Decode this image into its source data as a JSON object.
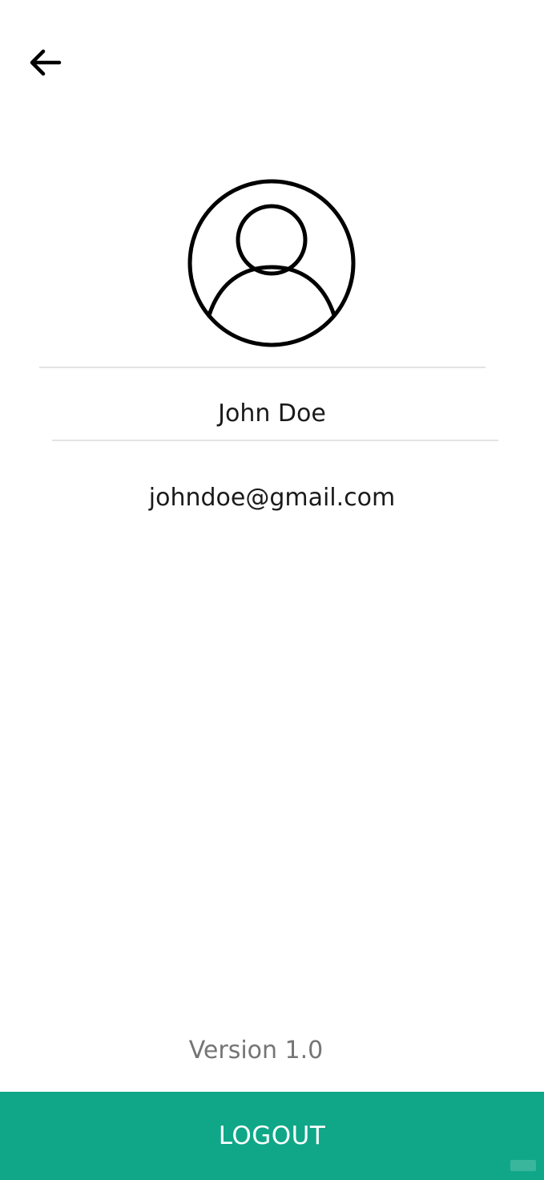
{
  "header": {
    "back_icon": "arrow-left-icon"
  },
  "profile": {
    "avatar_icon": "account-circle-icon",
    "name": "John Doe",
    "email": "johndoe@gmail.com"
  },
  "footer": {
    "version": "Version 1.0",
    "logout_label": "LOGOUT"
  },
  "colors": {
    "accent": "#0fa788",
    "text_primary": "#1a1a1a",
    "text_secondary": "#757575",
    "divider": "#e4e4e4",
    "background": "#ffffff"
  }
}
